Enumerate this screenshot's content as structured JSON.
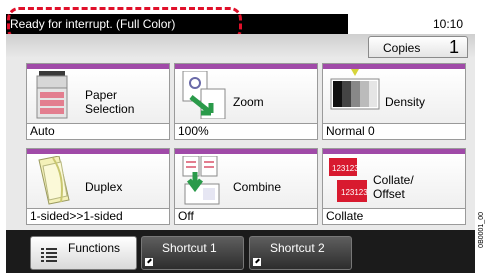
{
  "status": {
    "message": "Ready for interrupt. (Full Color)",
    "time": "10:10"
  },
  "copies": {
    "label": "Copies",
    "count": "1"
  },
  "tiles": [
    {
      "name": "paper-selection",
      "label": "Paper Selection",
      "value": "Auto",
      "icon": "copier-icon"
    },
    {
      "name": "zoom",
      "label": "Zoom",
      "value": "100%",
      "icon": "zoom-icon"
    },
    {
      "name": "density",
      "label": "Density",
      "value": "Normal 0",
      "icon": "density-icon"
    },
    {
      "name": "duplex",
      "label": "Duplex",
      "value": "1-sided>>1-sided",
      "icon": "duplex-icon"
    },
    {
      "name": "combine",
      "label": "Combine",
      "value": "Off",
      "icon": "combine-icon"
    },
    {
      "name": "collate",
      "label": "Collate/ Offset",
      "value": "Collate",
      "icon": "collate-icon",
      "icon_text": "123123"
    }
  ],
  "nav": {
    "functions": "Functions",
    "shortcut1": "Shortcut 1",
    "shortcut2": "Shortcut 2"
  },
  "side_code": "0B0001_00",
  "colors": {
    "accent": "#a04aa8",
    "callout": "#e0102a",
    "zoom_arrow": "#2a9a4a"
  }
}
